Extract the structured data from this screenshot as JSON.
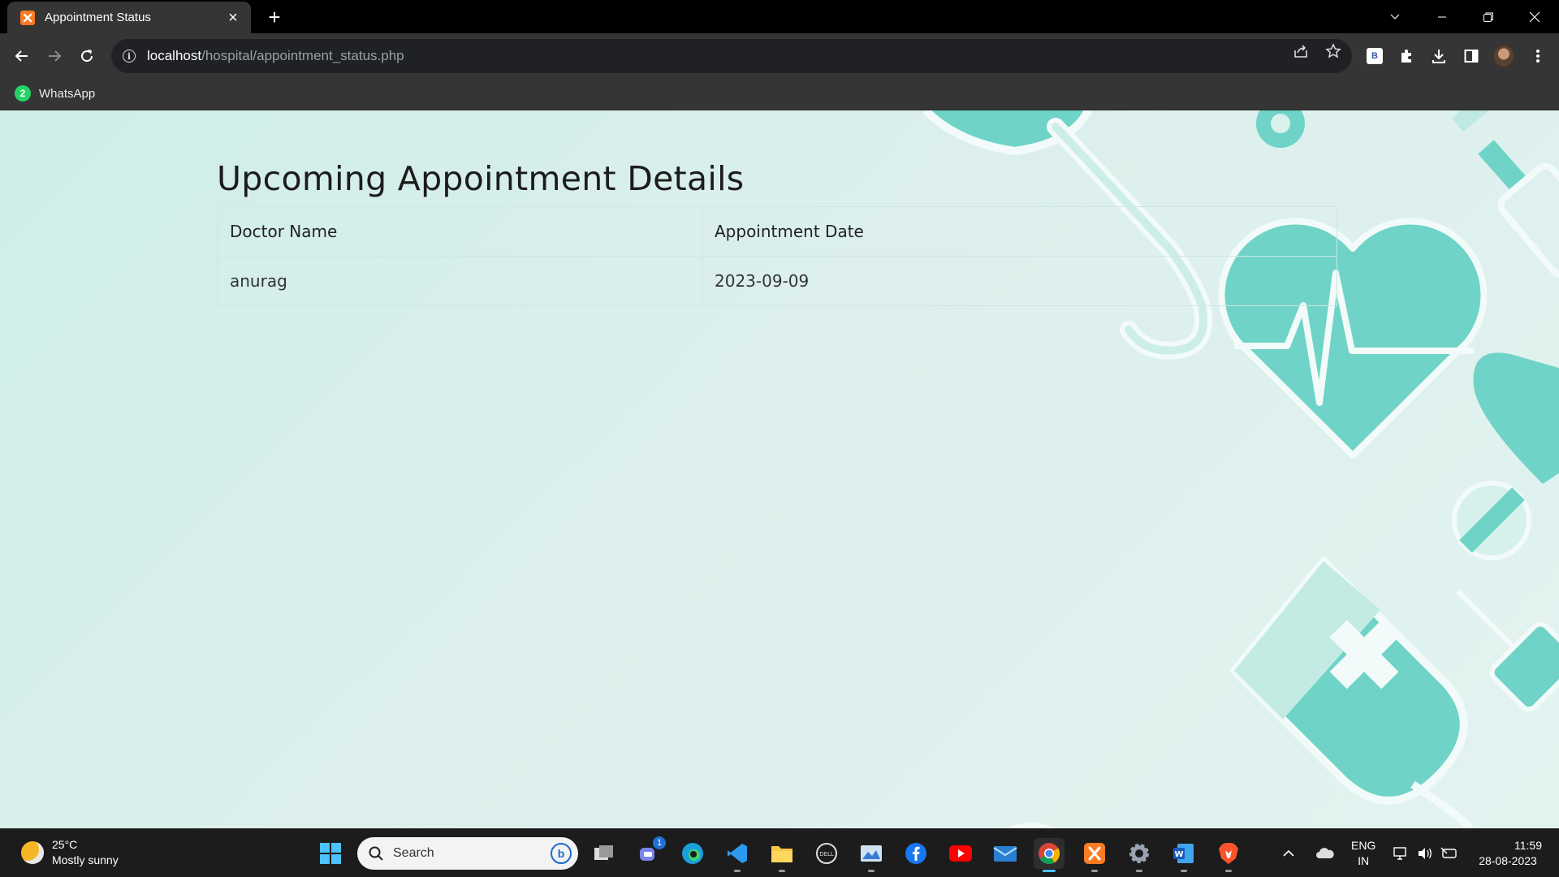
{
  "browser": {
    "tab_title": "Appointment Status",
    "url_host": "localhost",
    "url_path": "/hospital/appointment_status.php",
    "bookmarks": [
      {
        "label": "WhatsApp",
        "badge": "2"
      }
    ]
  },
  "page": {
    "heading": "Upcoming Appointment Details",
    "table": {
      "headers": [
        "Doctor Name",
        "Appointment Date"
      ],
      "rows": [
        [
          "anurag",
          "2023-09-09"
        ]
      ]
    }
  },
  "taskbar": {
    "weather_temp": "25°C",
    "weather_desc": "Mostly sunny",
    "search_label": "Search",
    "chat_badge": "1",
    "language_line1": "ENG",
    "language_line2": "IN",
    "time": "11:59",
    "date": "28-08-2023"
  },
  "colors": {
    "accent_teal": "#6fd3c7",
    "page_bg": "#d7efeb",
    "browser_chrome": "#353535"
  }
}
